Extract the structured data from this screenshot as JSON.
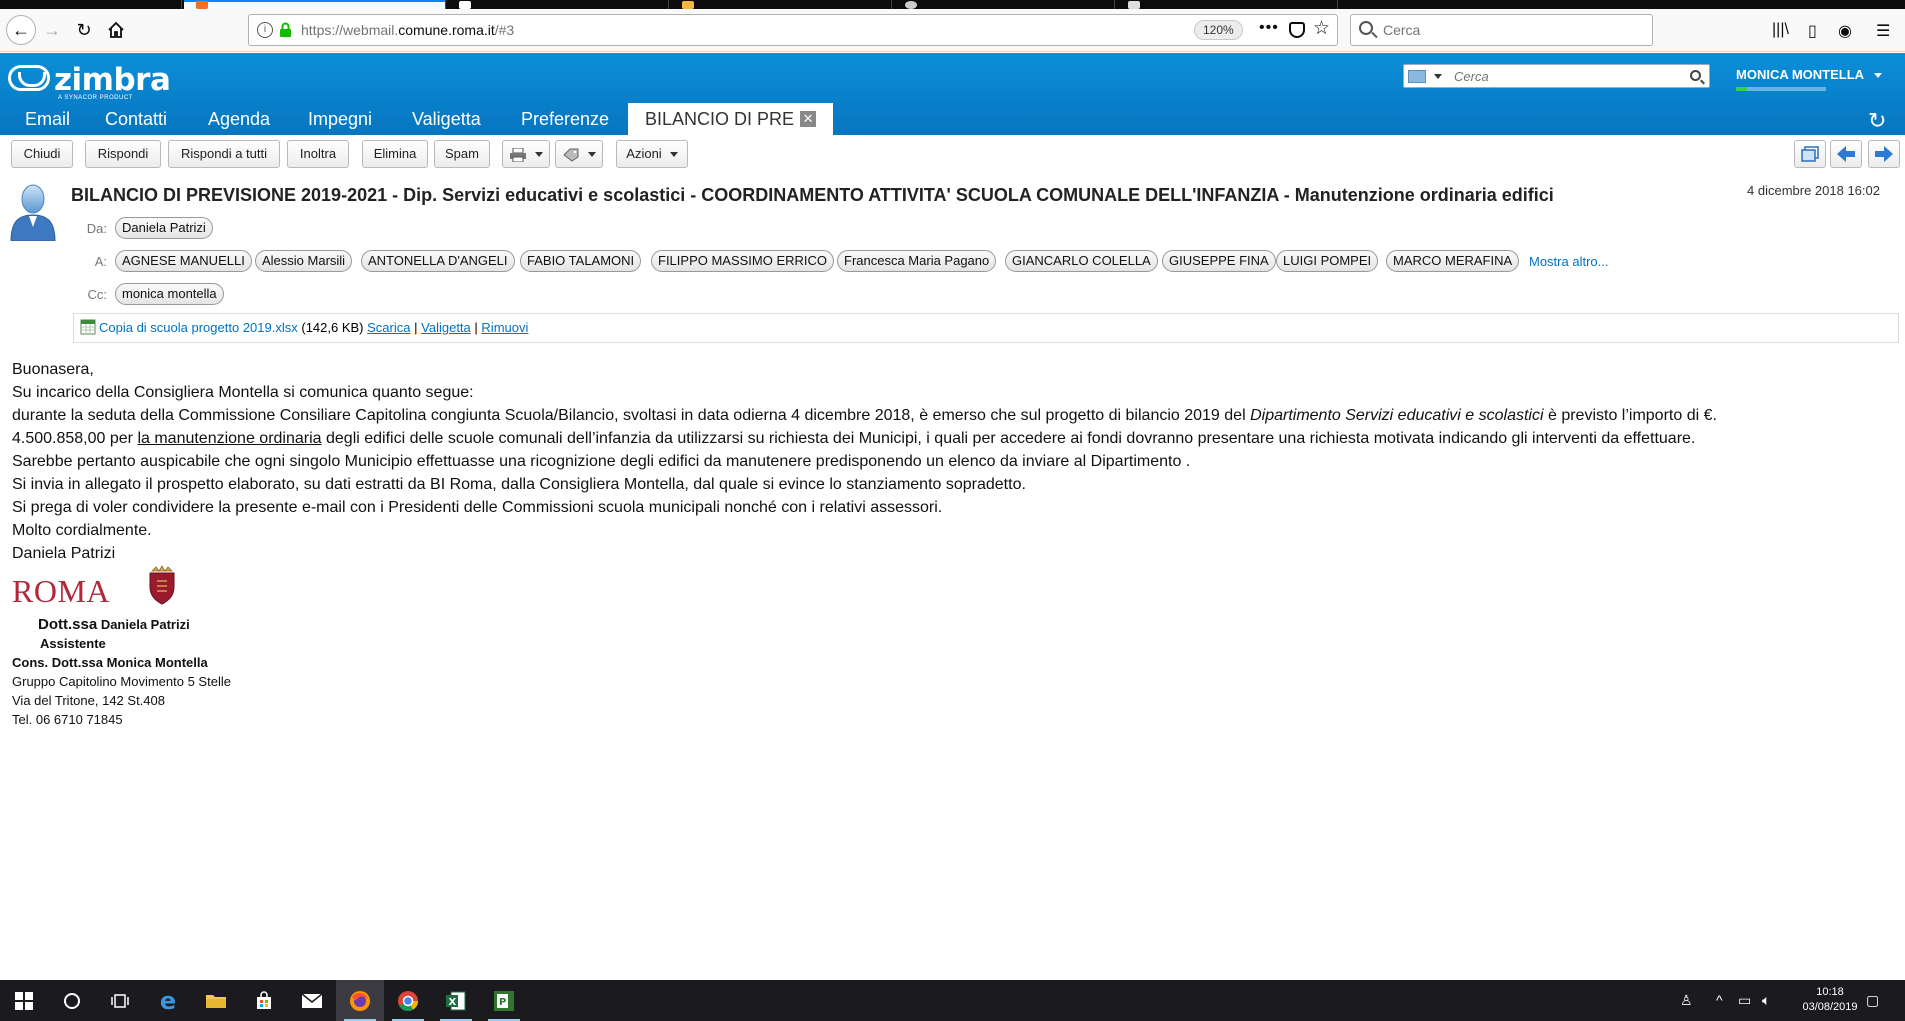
{
  "browser": {
    "url_prefix": "https://webmail.",
    "url_domain": "comune.roma.it",
    "url_suffix": "/#3",
    "zoom": "120%",
    "search_placeholder": "Cerca"
  },
  "zimbra": {
    "logo_text": "zimbra",
    "logo_sub": "A SYNACOR PRODUCT",
    "search_placeholder": "Cerca",
    "user_name": "MONICA MONTELLA",
    "quota_fraction": 0.12,
    "tabs": [
      {
        "label": "Email"
      },
      {
        "label": "Contatti"
      },
      {
        "label": "Agenda"
      },
      {
        "label": "Impegni"
      },
      {
        "label": "Valigetta"
      },
      {
        "label": "Preferenze"
      }
    ],
    "active_tab": "BILANCIO DI PRE"
  },
  "toolbar": {
    "close": "Chiudi",
    "reply": "Rispondi",
    "reply_all": "Rispondi a tutti",
    "forward": "Inoltra",
    "delete": "Elimina",
    "spam": "Spam",
    "actions": "Azioni"
  },
  "message": {
    "subject": "BILANCIO DI PREVISIONE 2019-2021 - Dip. Servizi educativi e scolastici - COORDINAMENTO ATTIVITA' SCUOLA COMUNALE DELL'INFANZIA - Manutenzione ordinaria edifici",
    "date": "4 dicembre 2018 16:02",
    "from_label": "Da:",
    "from": "Daniela Patrizi",
    "to_label": "A:",
    "to": [
      "AGNESE MANUELLI",
      "Alessio Marsili",
      "ANTONELLA D'ANGELI",
      "FABIO TALAMONI",
      "FILIPPO MASSIMO ERRICO",
      "Francesca Maria Pagano",
      "GIANCARLO COLELLA",
      "GIUSEPPE FINA",
      "LUIGI POMPEI",
      "MARCO MERAFINA"
    ],
    "more": "Mostra altro...",
    "cc_label": "Cc:",
    "cc": "monica montella",
    "attachment": {
      "name": "Copia di scuola progetto 2019.xlsx",
      "size": "(142,6 KB)",
      "download": "Scarica",
      "briefcase": "Valigetta",
      "remove": "Rimuovi",
      "sep": "|"
    }
  },
  "body": {
    "l1": "Buonasera,",
    "l2": "Su incarico della Consigliera Montella si comunica quanto segue:",
    "l3a": "durante la seduta della Commissione Consiliare  Capitolina congiunta Scuola/Bilancio, svoltasi in data odierna 4 dicembre 2018, è emerso che sul progetto di bilancio  2019 del ",
    "l3b": "Dipartimento Servizi educativi e scolastici",
    "l3c": "  è previsto l’importo di €.",
    "l4a": "4.500.858,00 per ",
    "l4b": "la manutenzione ordinaria",
    "l4c": " degli edifici delle scuole comunali dell’infanzia da utilizzarsi su richiesta dei Municipi, i quali per accedere ai fondi dovranno presentare una richiesta motivata indicando gli interventi da effettuare.",
    "l5": "Sarebbe pertanto auspicabile che ogni singolo Municipio effettuasse una ricognizione degli edifici da manutenere predisponendo un elenco da inviare al Dipartimento .",
    "l6": "Si invia in allegato il prospetto elaborato, su dati estratti da BI Roma,  dalla Consigliera Montella, dal quale si evince lo stanziamento sopradetto.",
    "l7": "Si prega di voler condividere la presente e-mail con i Presidenti delle Commissioni scuola municipali nonché con i relativi assessori.",
    "l8": "Molto cordialmente.",
    "l9": "Daniela Patrizi"
  },
  "signature": {
    "logo": "ROMA",
    "title_prefix": "Dott.ssa",
    "name": "Daniela Patrizi",
    "role": "Assistente",
    "office": "Cons. Dott.ssa Monica Montella",
    "group": "Gruppo Capitolino Movimento 5 Stelle",
    "address": "Via del Tritone, 142 St.408",
    "phone": "Tel. 06 6710 71845"
  },
  "taskbar": {
    "time": "10:18",
    "date": "03/08/2019"
  }
}
